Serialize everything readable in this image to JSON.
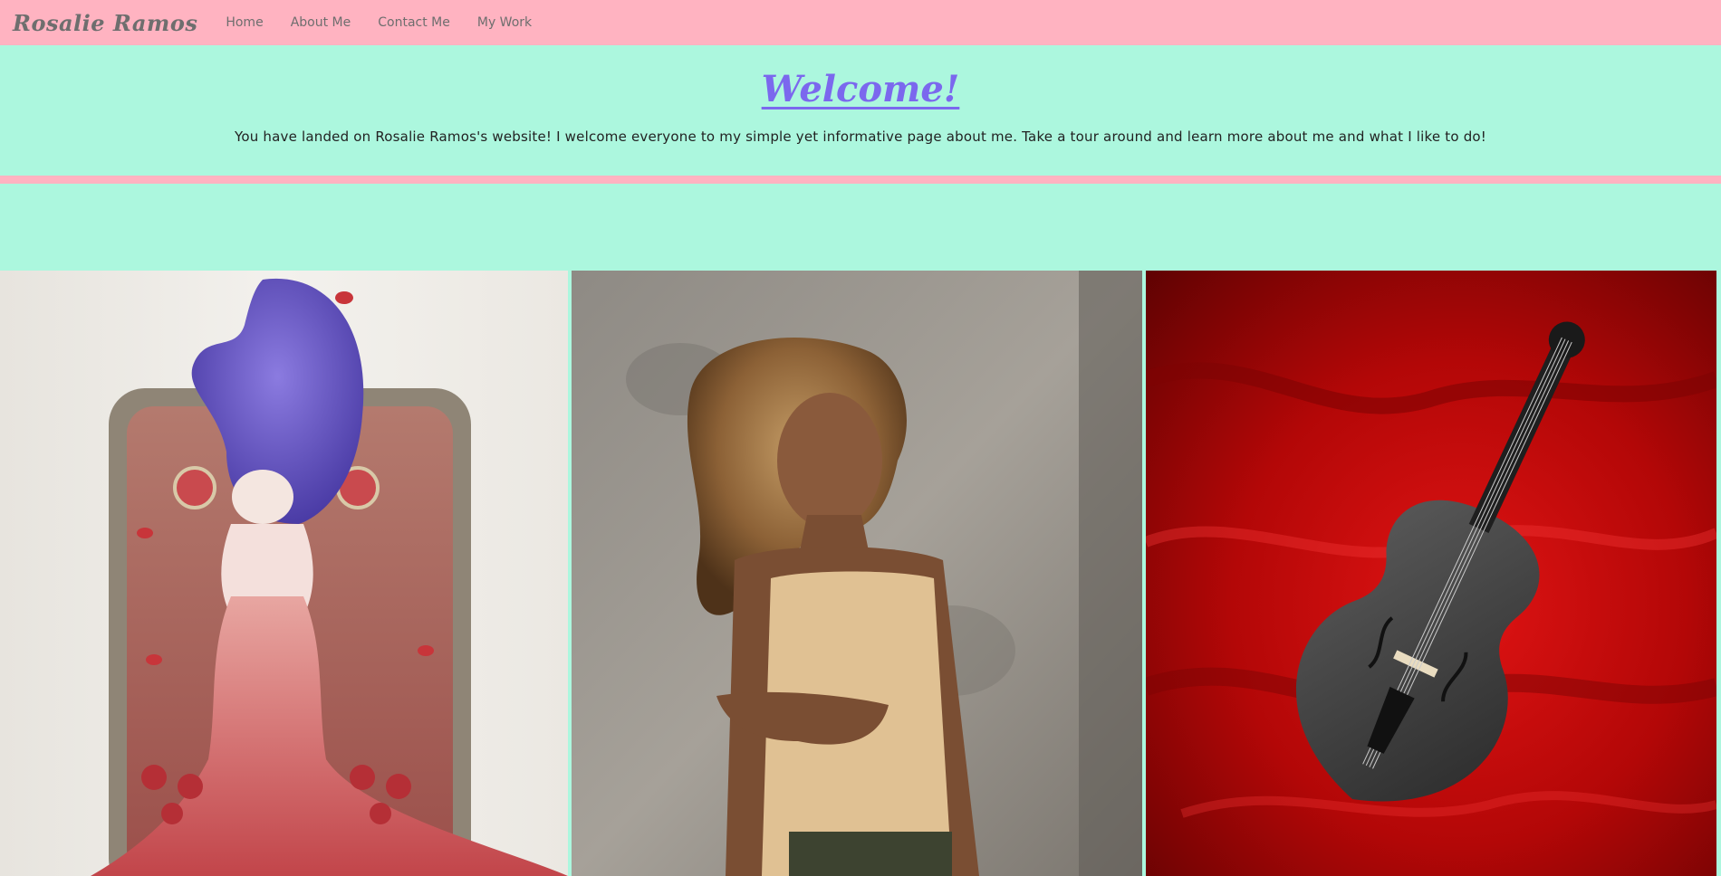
{
  "nav": {
    "brand": "Rosalie Ramos",
    "links": [
      "Home",
      "About Me",
      "Contact Me",
      "My Work"
    ]
  },
  "hero": {
    "title": "Welcome!",
    "message": "You have landed on Rosalie Ramos's website! I welcome everyone to my simple yet informative page about me. Take a tour around and learn more about me and what I like to do!"
  },
  "gallery": {
    "photos": [
      {
        "icon": "figurine-photo"
      },
      {
        "icon": "portrait-photo"
      },
      {
        "icon": "violin-photo"
      }
    ]
  },
  "colors": {
    "navbar": "#ffb3c1",
    "background": "#acf7de",
    "title": "#7b68ee",
    "nav_text": "#6e6e6e"
  }
}
